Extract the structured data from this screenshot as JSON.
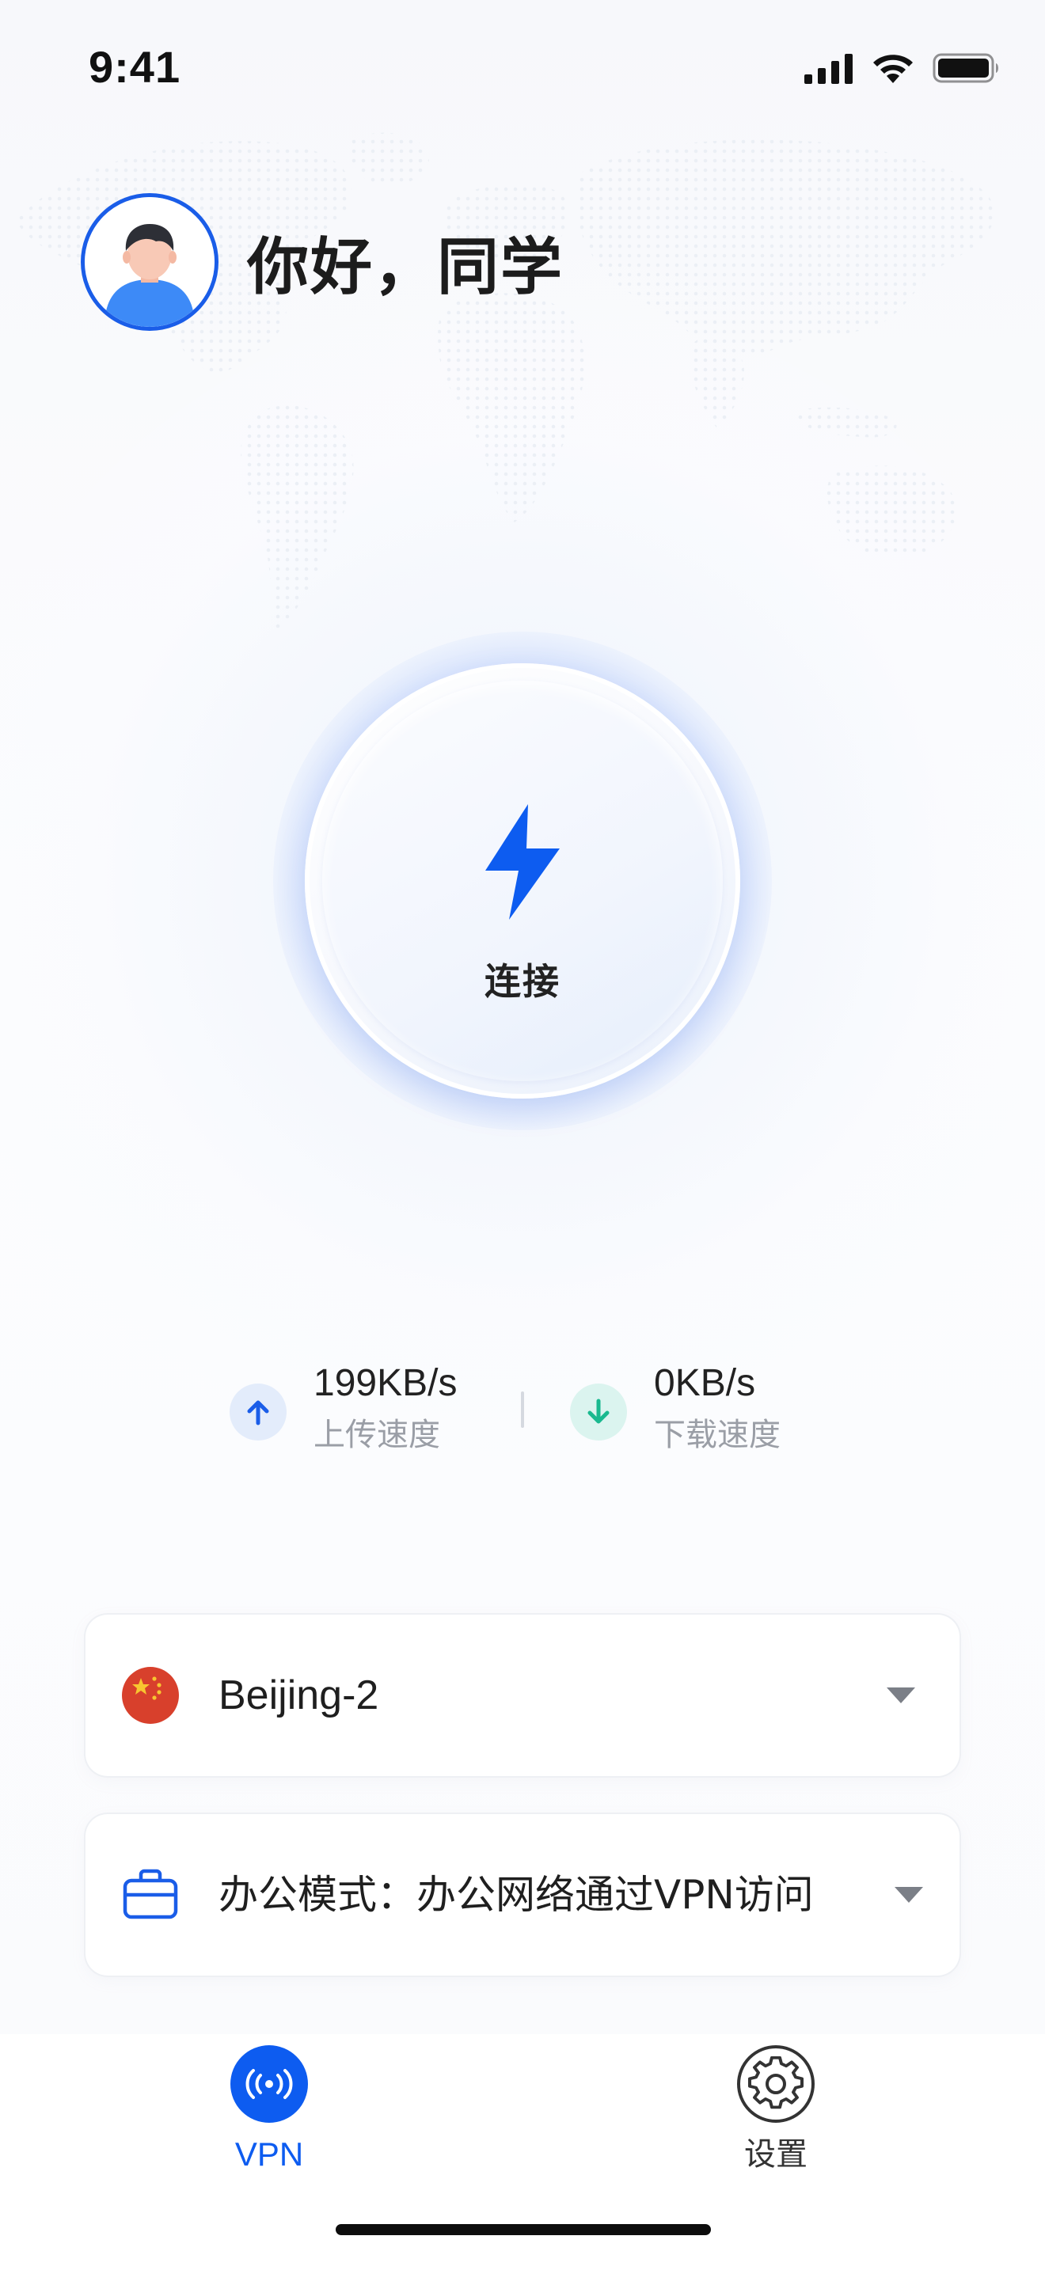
{
  "status_bar": {
    "time": "9:41"
  },
  "header": {
    "greeting": "你好，同学"
  },
  "connect": {
    "label": "连接"
  },
  "speed": {
    "upload_value": "199KB/s",
    "upload_label": "上传速度",
    "download_value": "0KB/s",
    "download_label": "下载速度"
  },
  "server_select": {
    "value": "Beijing-2",
    "flag_icon": "china-flag-icon"
  },
  "mode_select": {
    "value": "办公模式：办公网络通过VPN访问",
    "icon": "briefcase-icon"
  },
  "tab_bar": {
    "tabs": [
      {
        "label": "VPN",
        "icon": "wireless-signal-icon",
        "active": true
      },
      {
        "label": "设置",
        "icon": "gear-icon",
        "active": false
      }
    ]
  },
  "colors": {
    "accent": "#0d5cf0",
    "upload_icon": "#1a5de8",
    "download_icon": "#19b98f",
    "flag_red": "#d8402c",
    "flag_yellow": "#f8c630"
  }
}
